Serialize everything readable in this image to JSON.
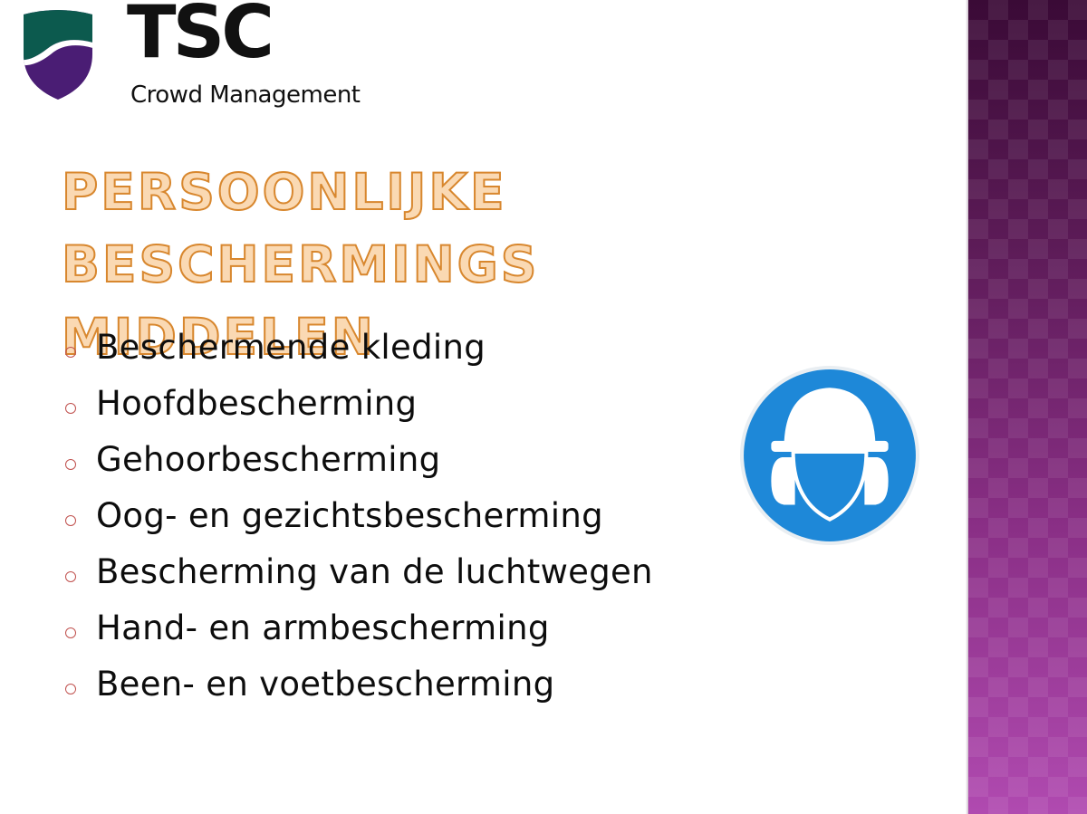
{
  "logo": {
    "brand": "TSC",
    "subtitle": "Crowd Management",
    "colors": {
      "shield_top": "#0c5a4e",
      "shield_bottom": "#4a1d74",
      "text": "#111111"
    }
  },
  "slide": {
    "title_line1": "PERSOONLIJKE BESCHERMINGS",
    "title_line2": "MIDDELEN",
    "title_colors": {
      "fill": "#fad9b3",
      "outline": "#d8872e"
    },
    "bullet_color": "#c0504d",
    "accent_band_color": "#8a2f86",
    "items": [
      {
        "label": "Beschermende kleding"
      },
      {
        "label": "Hoofdbescherming"
      },
      {
        "label": "Gehoorbescherming"
      },
      {
        "label": "Oog- en gezichtsbescherming"
      },
      {
        "label": "Bescherming van de luchtwegen"
      },
      {
        "label": "Hand- en armbescherming"
      },
      {
        "label": "Been- en voetbescherming"
      }
    ]
  },
  "sign": {
    "icon": "head-and-ear-protection-icon",
    "color": "#1e88d8"
  }
}
